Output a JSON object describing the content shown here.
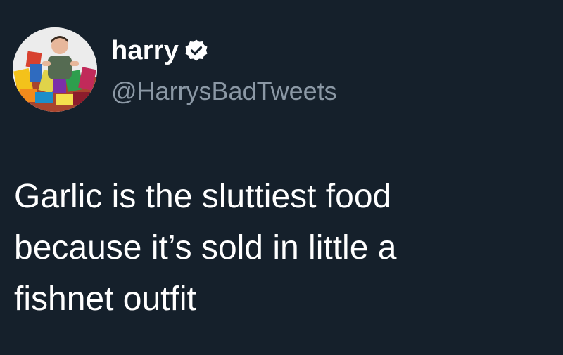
{
  "author": {
    "display_name": "harry",
    "handle": "@HarrysBadTweets",
    "verified": true,
    "verified_icon": "verified-badge-icon",
    "avatar_icon": "profile-photo-avatar"
  },
  "tweet": {
    "lines": [
      "Garlic is the sluttiest food",
      "because it’s sold in little a",
      "fishnet outfit"
    ]
  },
  "colors": {
    "background": "#15202b",
    "text": "#ffffff",
    "secondary_text": "#8b98a5"
  }
}
